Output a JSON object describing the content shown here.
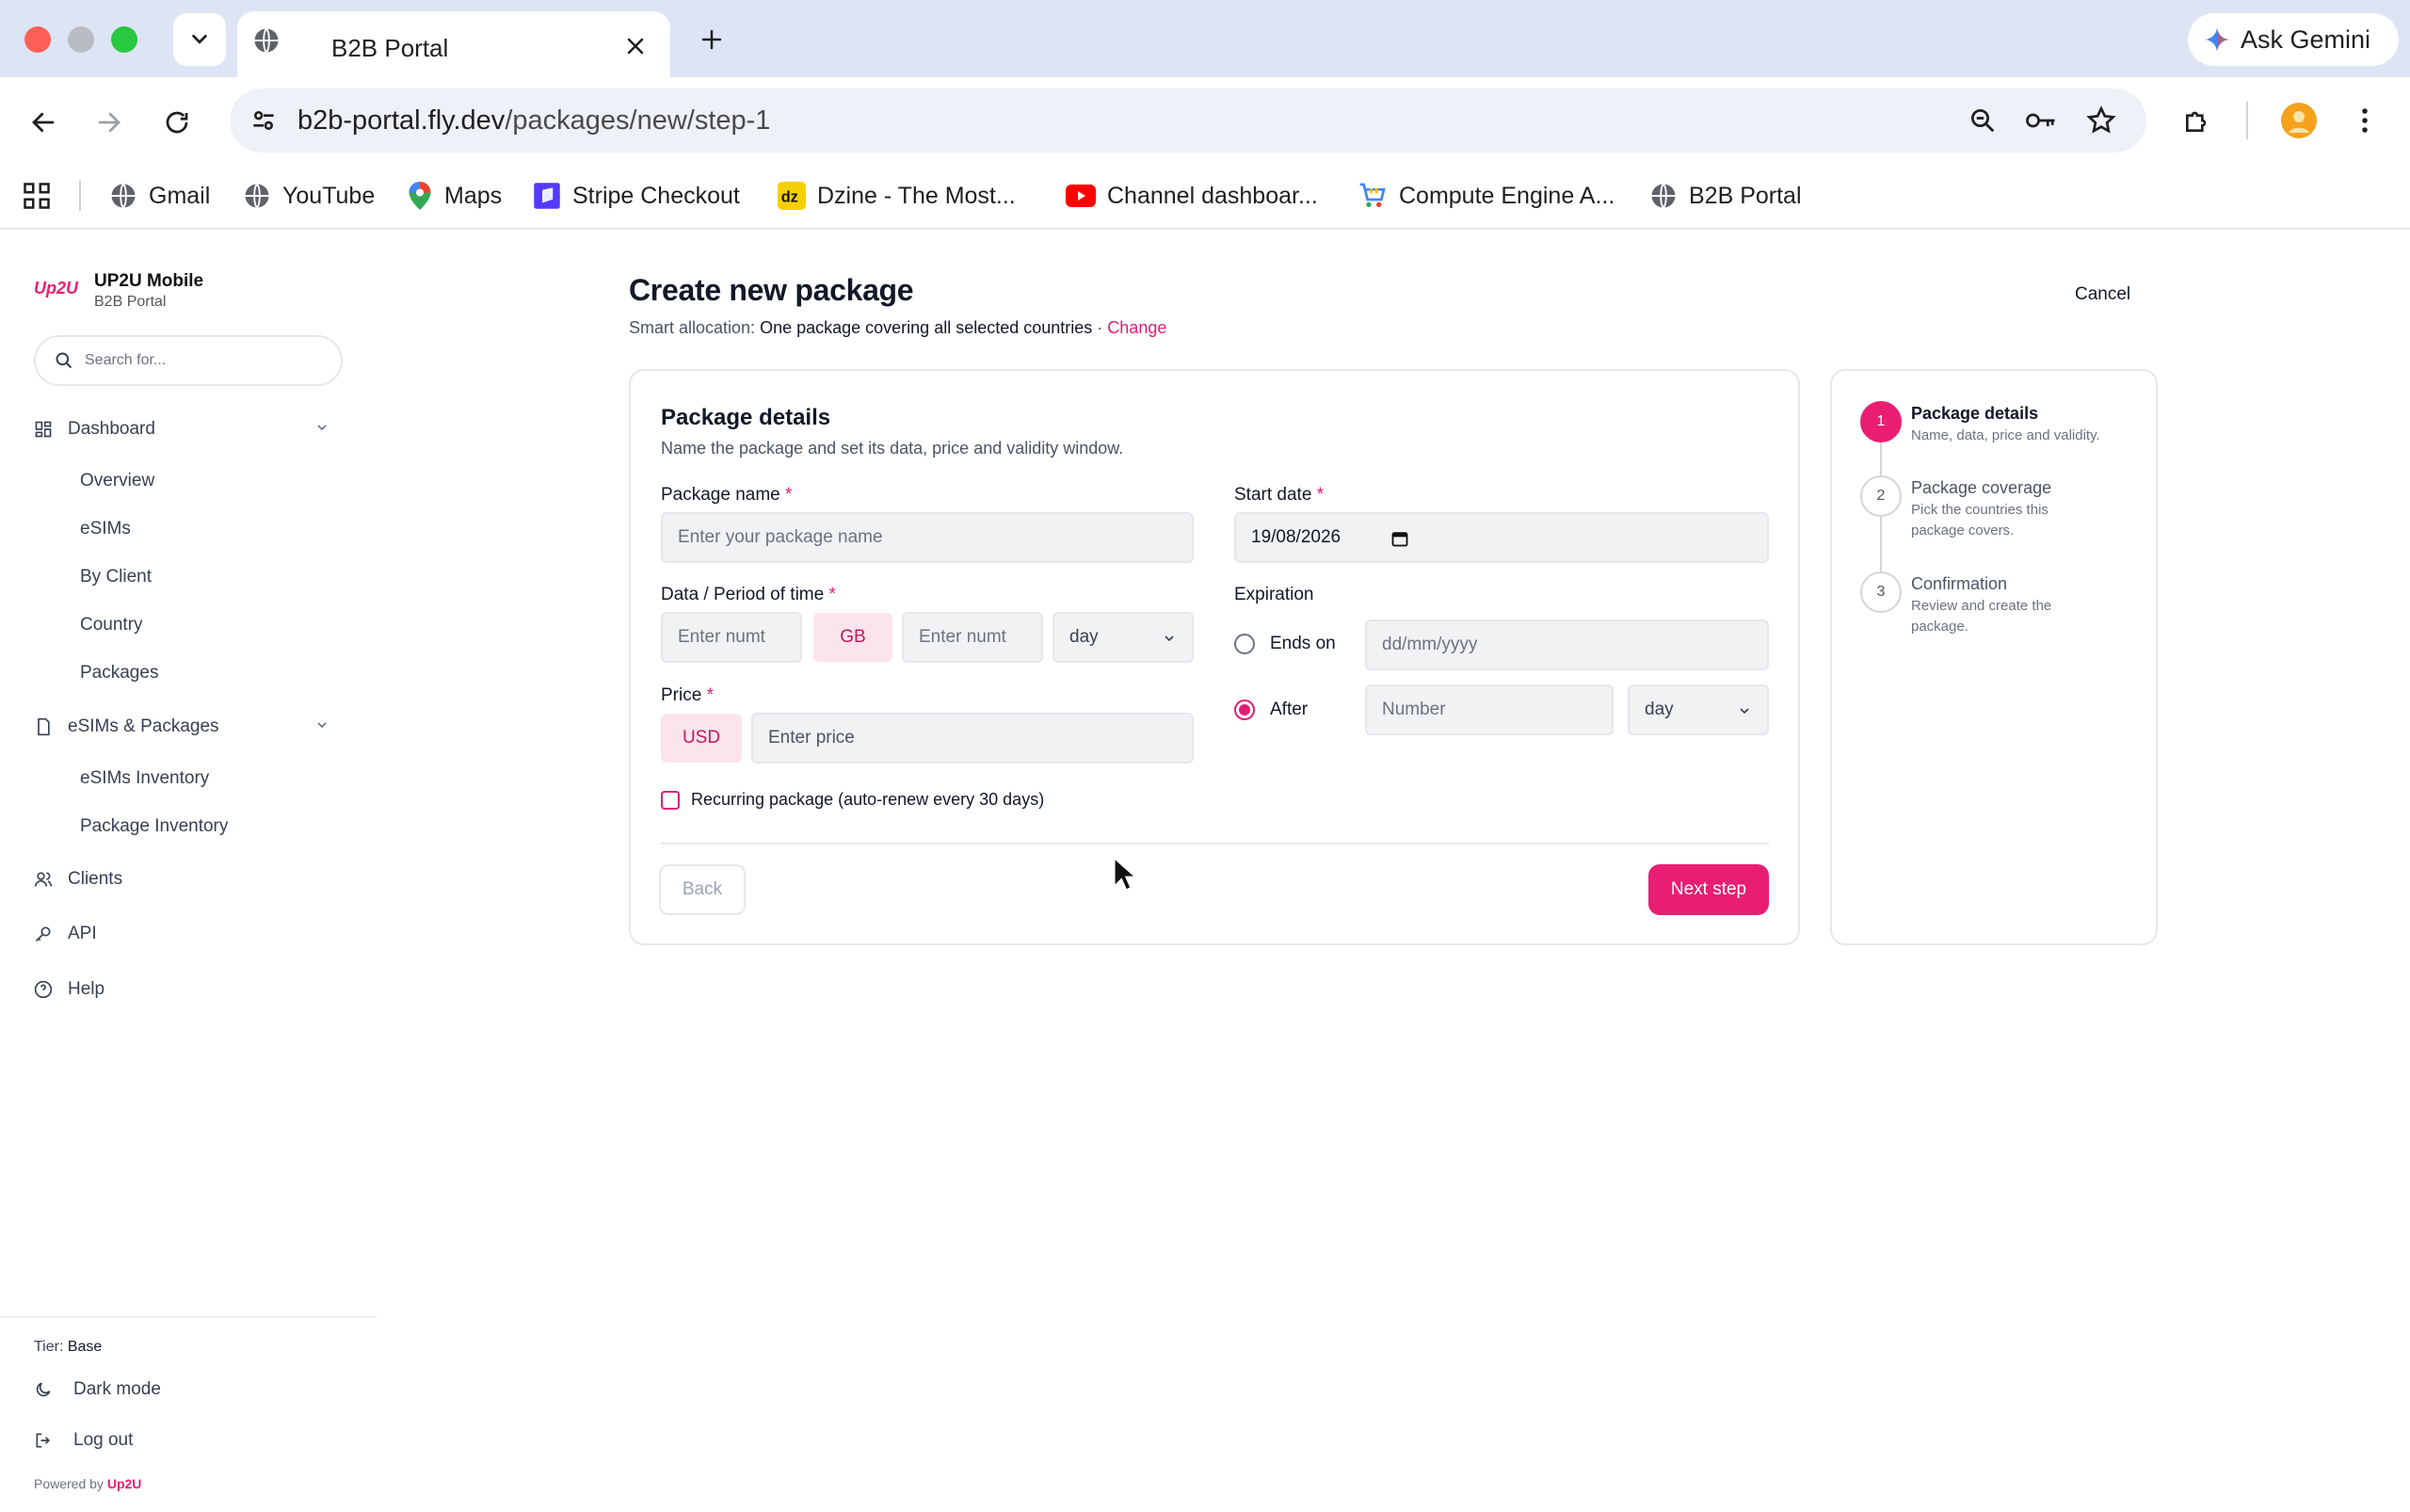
{
  "browser": {
    "tab_title": "B2B Portal",
    "ask_gemini": "Ask Gemini",
    "url_host": "b2b-portal.fly.dev",
    "url_path": "/packages/new/step-1",
    "bookmarks": [
      {
        "label": "Gmail",
        "icon": "globe-icon"
      },
      {
        "label": "YouTube",
        "icon": "globe-icon"
      },
      {
        "label": "Maps",
        "icon": "maps-pin-icon"
      },
      {
        "label": "Stripe Checkout",
        "icon": "stripe-icon"
      },
      {
        "label": "Dzine - The Most...",
        "icon": "dzine-icon"
      },
      {
        "label": "Channel dashboar...",
        "icon": "youtube-icon"
      },
      {
        "label": "Compute Engine A...",
        "icon": "cart-icon"
      },
      {
        "label": "B2B Portal",
        "icon": "globe-icon"
      }
    ]
  },
  "sidebar": {
    "logo_text": "Up2U",
    "brand_name": "UP2U Mobile",
    "brand_sub": "B2B Portal",
    "search_placeholder": "Search for...",
    "dashboard_label": "Dashboard",
    "dashboard_items": [
      "Overview",
      "eSIMs",
      "By Client",
      "Country",
      "Packages"
    ],
    "esims_label": "eSIMs & Packages",
    "esims_items": [
      "eSIMs Inventory",
      "Package Inventory"
    ],
    "clients": "Clients",
    "api": "API",
    "help": "Help",
    "tier_label": "Tier:",
    "tier_value": "Base",
    "dark_mode": "Dark mode",
    "log_out": "Log out",
    "powered_by": "Powered by",
    "powered_brand": "Up2U"
  },
  "header": {
    "title": "Create new package",
    "smart_label": "Smart allocation:",
    "smart_value": "One package covering all selected countries",
    "smart_sep": " · ",
    "change": "Change",
    "cancel": "Cancel"
  },
  "form": {
    "section_title": "Package details",
    "section_desc": "Name the package and set its data, price and validity window.",
    "package_name_label": "Package name",
    "package_name_placeholder": "Enter your package name",
    "start_date_label": "Start date",
    "start_date_value": "19/08/2026",
    "data_period_label": "Data / Period of time",
    "data_placeholder": "Enter numt",
    "data_unit": "GB",
    "period_placeholder": "Enter numt",
    "period_unit": "day",
    "expiration_label": "Expiration",
    "ends_on_label": "Ends on",
    "ends_on_placeholder": "dd/mm/yyyy",
    "after_label": "After",
    "after_placeholder": "Number",
    "after_unit": "day",
    "expiration_selected": "After",
    "price_label": "Price",
    "currency": "USD",
    "price_placeholder": "Enter price",
    "recurring_label": "Recurring package (auto-renew every 30 days)",
    "recurring_checked": false,
    "back": "Back",
    "next": "Next step",
    "required_mark": "*"
  },
  "steps": [
    {
      "num": "1",
      "title": "Package details",
      "desc": "Name, data, price and validity.",
      "active": true
    },
    {
      "num": "2",
      "title": "Package coverage",
      "desc": "Pick the countries this package covers.",
      "active": false
    },
    {
      "num": "3",
      "title": "Confirmation",
      "desc": "Review and create the package.",
      "active": false
    }
  ],
  "colors": {
    "accent": "#e91e72",
    "chrome": "#dde5f4"
  }
}
